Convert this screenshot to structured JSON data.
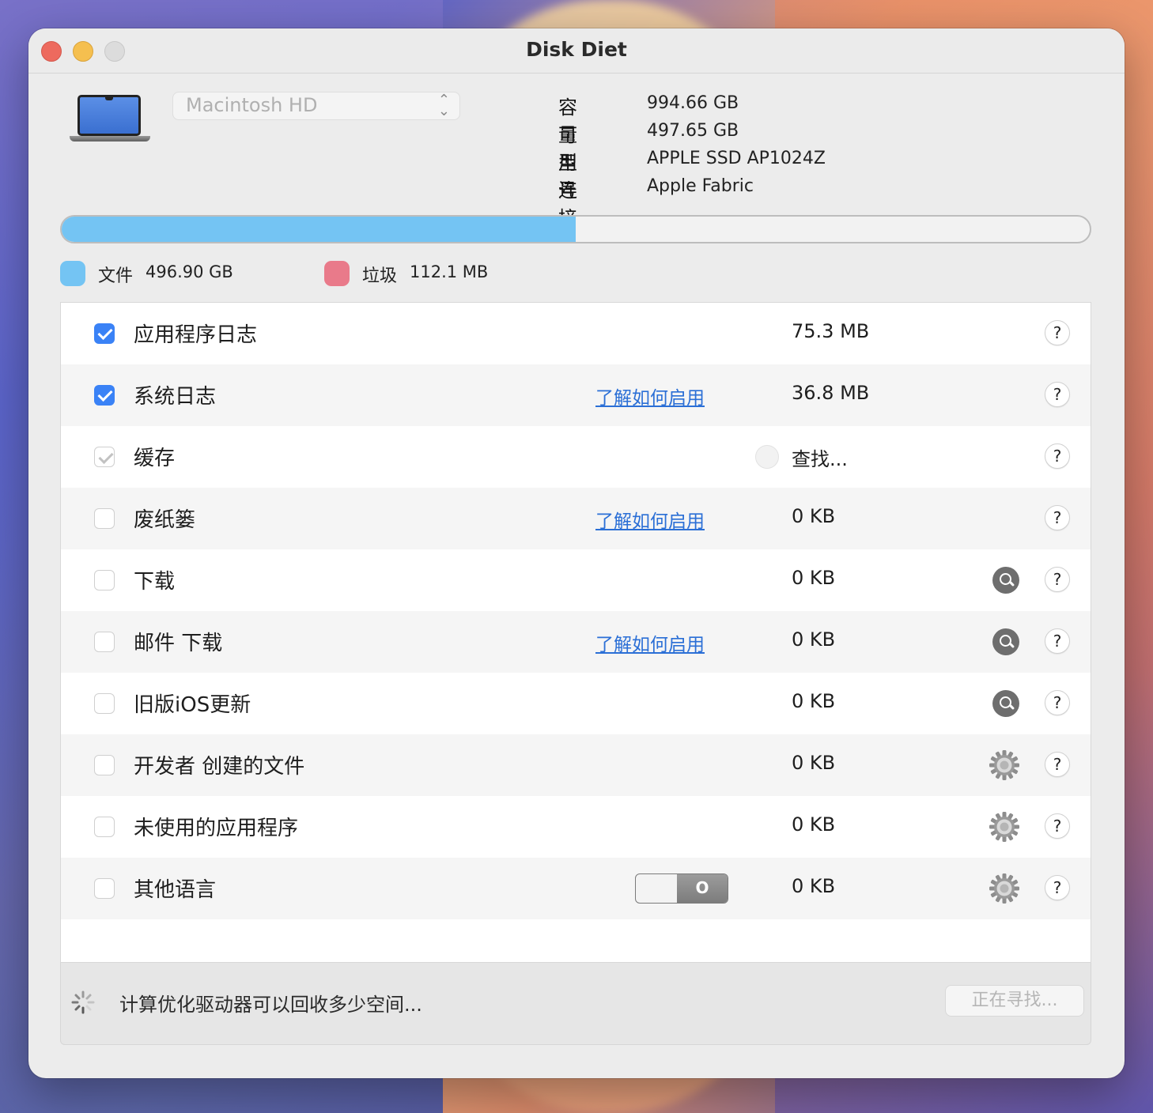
{
  "window": {
    "title": "Disk Diet"
  },
  "disk": {
    "selected": "Macintosh HD",
    "info": [
      {
        "key": "容量",
        "value": "994.66 GB"
      },
      {
        "key": "可用",
        "value": "497.65 GB"
      },
      {
        "key": "型号",
        "value": "APPLE SSD AP1024Z"
      },
      {
        "key": "连接",
        "value": "Apple Fabric"
      }
    ]
  },
  "usage": {
    "used_fraction": 0.5,
    "fill_color": "#74c4f3"
  },
  "legend": [
    {
      "label": "文件",
      "value": "496.90 GB",
      "color": "#74c4f3"
    },
    {
      "label": "垃圾",
      "value": "112.1 MB",
      "color": "#e97a8a"
    }
  ],
  "items": [
    {
      "name": "应用程序日志",
      "checked": "on",
      "link": "",
      "size": "75.3 MB",
      "action": ""
    },
    {
      "name": "系统日志",
      "checked": "on",
      "link": "了解如何启用",
      "size": "36.8 MB",
      "action": ""
    },
    {
      "name": "缓存",
      "checked": "dim",
      "link": "",
      "size": "查找...",
      "action": ""
    },
    {
      "name": "废纸篓",
      "checked": "off",
      "link": "了解如何启用",
      "size": "0 KB",
      "action": ""
    },
    {
      "name": "下载",
      "checked": "off",
      "link": "",
      "size": "0 KB",
      "action": "magnifier-icon"
    },
    {
      "name": "邮件 下载",
      "checked": "off",
      "link": "了解如何启用",
      "size": "0 KB",
      "action": "magnifier-icon"
    },
    {
      "name": "旧版iOS更新",
      "checked": "off",
      "link": "",
      "size": "0 KB",
      "action": "magnifier-icon"
    },
    {
      "name": "开发者 创建的文件",
      "checked": "off",
      "link": "",
      "size": "0 KB",
      "action": "gear-icon"
    },
    {
      "name": "未使用的应用程序",
      "checked": "off",
      "link": "",
      "size": "0 KB",
      "action": "gear-icon"
    },
    {
      "name": "其他语言",
      "checked": "off",
      "link": "",
      "size": "0 KB",
      "action": "gear-icon",
      "toggle": "O"
    }
  ],
  "help_label": "?",
  "footer": {
    "status": "计算优化驱动器可以回收多少空间...",
    "button": "正在寻找..."
  }
}
